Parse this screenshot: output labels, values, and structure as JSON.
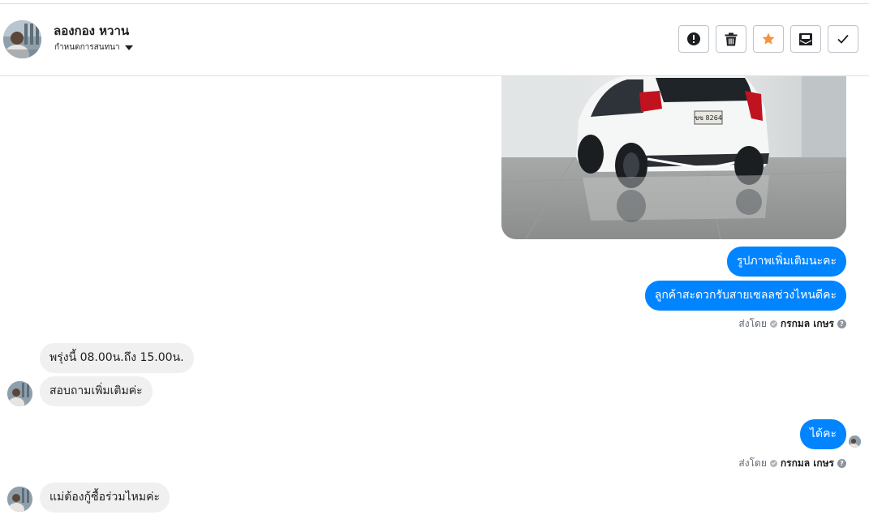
{
  "header": {
    "contact_name": "ลองกอง หวาน",
    "assign_label": "กำหนดการสนทนา",
    "actions": [
      {
        "name": "mark-spam-button",
        "icon": "exclamation-circle-icon"
      },
      {
        "name": "delete-button",
        "icon": "trash-icon"
      },
      {
        "name": "star-button",
        "icon": "star-icon"
      },
      {
        "name": "mark-unread-button",
        "icon": "envelope-icon"
      },
      {
        "name": "mark-done-button",
        "icon": "checkmark-icon"
      }
    ]
  },
  "messages": {
    "photo": {
      "plate_text": "ขข 8264"
    },
    "out1": "รูปภาพเพิ่มเติมนะคะ",
    "out2": "ลูกค้าสะดวกรับสายเซลลช่วงไหนดีคะ",
    "sent_by_1": {
      "prefix": "ส่งโดย",
      "name": "กรกมล เกษร"
    },
    "in1": "พรุ่งนี้ 08.00น.ถึง 15.00น.",
    "in2": "สอบถามเพิ่มเติมค่ะ",
    "out3": "ได้คะ",
    "sent_by_2": {
      "prefix": "ส่งโดย",
      "name": "กรกมล เกษร"
    },
    "in3": "แม่ต้องกู้ซื้อร่วมไหมค่ะ"
  },
  "colors": {
    "outgoing_bubble": "#0084ff",
    "incoming_bubble": "#f1f0f0",
    "star": "#f7923b"
  }
}
